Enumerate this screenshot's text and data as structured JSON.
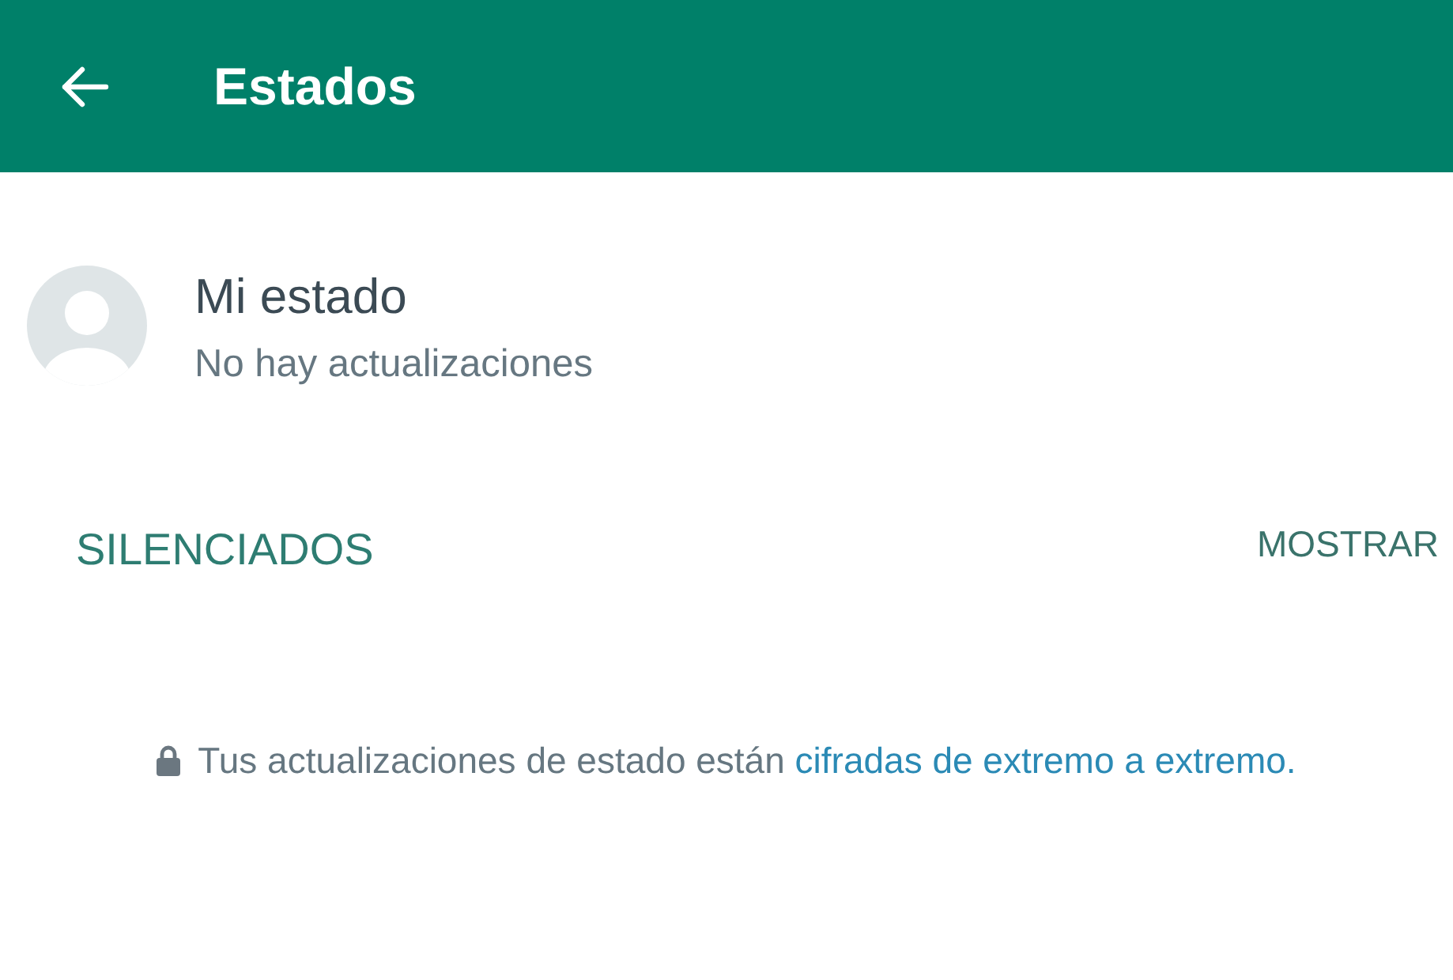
{
  "header": {
    "title": "Estados"
  },
  "my_status": {
    "name": "Mi estado",
    "subtitle": "No hay actualizaciones"
  },
  "muted_section": {
    "title": "SILENCIADOS",
    "action": "MOSTRAR"
  },
  "encryption_note": {
    "text": "Tus actualizaciones de estado están",
    "link": "cifradas de extremo a extremo."
  }
}
